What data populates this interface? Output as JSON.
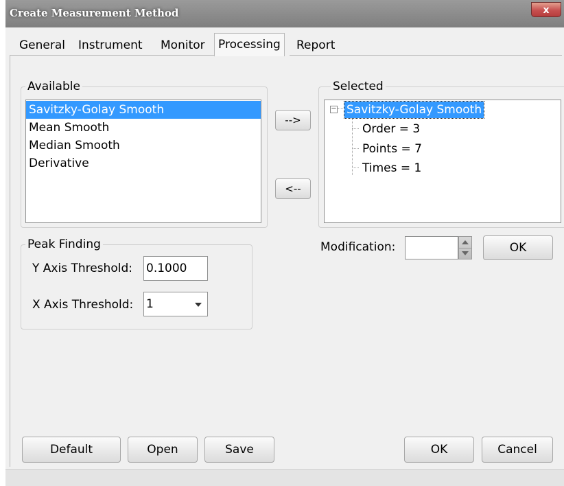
{
  "window": {
    "title": "Create Measurement Method",
    "close_glyph": "x"
  },
  "tabs": [
    {
      "label": "General"
    },
    {
      "label": "Instrument"
    },
    {
      "label": "Monitor"
    },
    {
      "label": "Processing"
    },
    {
      "label": "Report"
    }
  ],
  "active_tab": "Processing",
  "available": {
    "label": "Available",
    "items": [
      "Savitzky-Golay Smooth",
      "Mean Smooth",
      "Median Smooth",
      "Derivative"
    ],
    "selected_index": 0
  },
  "transfer": {
    "add_label": "-->",
    "remove_label": "<--"
  },
  "selected": {
    "label": "Selected",
    "expander": "−",
    "root": "Savitzky-Golay Smooth",
    "children": [
      "Order = 3",
      "Points = 7",
      "Times = 1"
    ]
  },
  "peak_finding": {
    "label": "Peak Finding",
    "y_label": "Y Axis Threshold:",
    "y_value": "0.1000",
    "x_label": "X Axis Threshold:",
    "x_value": "1"
  },
  "modification": {
    "label": "Modification:",
    "value": "",
    "ok_label": "OK"
  },
  "footer": {
    "default_label": "Default",
    "open_label": "Open",
    "save_label": "Save",
    "ok_label": "OK",
    "cancel_label": "Cancel"
  },
  "colors": {
    "selection": "#3399ff",
    "title_bar": "#8a8a8a",
    "close": "#c75050"
  }
}
